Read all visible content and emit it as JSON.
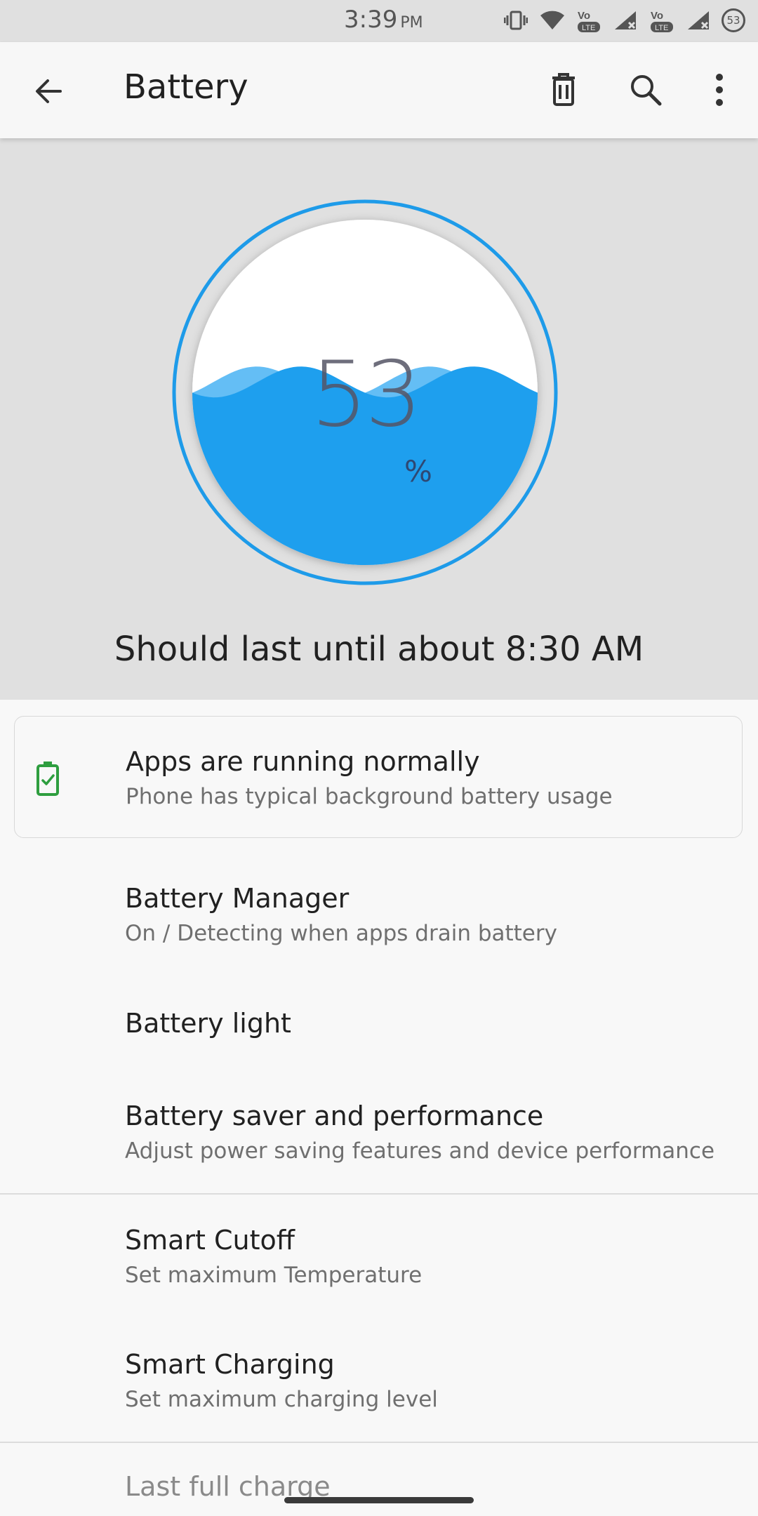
{
  "status": {
    "time": "3:39",
    "ampm": "PM",
    "battery_badge": "53",
    "lte1": "LTE",
    "lte2": "LTE",
    "icons": [
      "vibrate-icon",
      "wifi-icon",
      "volte-icon",
      "signal-icon",
      "volte-icon",
      "signal-icon",
      "battery-badge-icon"
    ]
  },
  "appbar": {
    "title": "Battery",
    "icons": [
      "back-arrow-icon",
      "delete-icon",
      "search-icon",
      "more-vert-icon"
    ]
  },
  "gauge": {
    "level_percent": 53,
    "percent_text": "53",
    "percent_sign": "%",
    "estimate": "Should last until about 8:30 AM",
    "colors": {
      "ring": "#1e9be9",
      "water": "#1e9fee",
      "wave_light": "#64bef5",
      "face": "#ffffff",
      "bg": "#e0e0e0"
    }
  },
  "tip": {
    "title": "Apps are running normally",
    "subtitle": "Phone has typical background battery usage",
    "icon": "battery-ok-icon",
    "icon_color": "#2e9e3f"
  },
  "items": [
    {
      "title": "Battery Manager",
      "subtitle": "On / Detecting when apps drain battery"
    },
    {
      "title": "Battery light",
      "subtitle": ""
    },
    {
      "title": "Battery saver and performance",
      "subtitle": "Adjust power saving features and device performance"
    },
    {
      "title": "Smart Cutoff",
      "subtitle": "Set maximum Temperature"
    },
    {
      "title": "Smart Charging",
      "subtitle": "Set maximum charging level"
    },
    {
      "title": "Last full charge",
      "subtitle": ""
    }
  ]
}
